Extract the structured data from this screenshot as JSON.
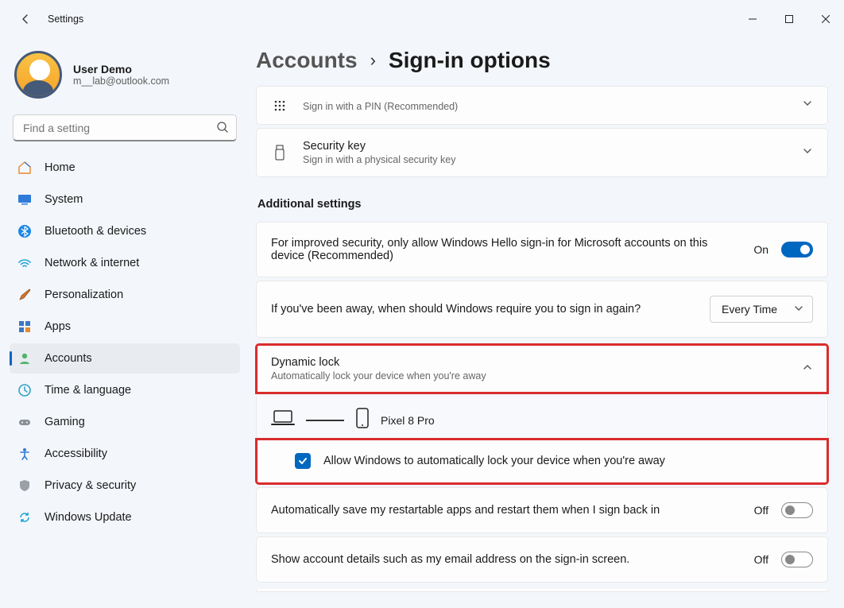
{
  "window": {
    "title": "Settings"
  },
  "user": {
    "name": "User Demo",
    "email": "m__lab@outlook.com"
  },
  "search": {
    "placeholder": "Find a setting"
  },
  "nav": [
    {
      "key": "home",
      "label": "Home"
    },
    {
      "key": "system",
      "label": "System"
    },
    {
      "key": "bluetooth",
      "label": "Bluetooth & devices"
    },
    {
      "key": "network",
      "label": "Network & internet"
    },
    {
      "key": "personalization",
      "label": "Personalization"
    },
    {
      "key": "apps",
      "label": "Apps"
    },
    {
      "key": "accounts",
      "label": "Accounts",
      "active": true
    },
    {
      "key": "time",
      "label": "Time & language"
    },
    {
      "key": "gaming",
      "label": "Gaming"
    },
    {
      "key": "accessibility",
      "label": "Accessibility"
    },
    {
      "key": "privacy",
      "label": "Privacy & security"
    },
    {
      "key": "update",
      "label": "Windows Update"
    }
  ],
  "breadcrumb": {
    "parent": "Accounts",
    "current": "Sign-in options"
  },
  "signin_methods": {
    "pin": {
      "title_visible_sub": "Sign in with a PIN (Recommended)"
    },
    "security_key": {
      "title": "Security key",
      "sub": "Sign in with a physical security key"
    }
  },
  "additional_header": "Additional settings",
  "hello_only": {
    "label": "For improved security, only allow Windows Hello sign-in for Microsoft accounts on this device (Recommended)",
    "state_text": "On"
  },
  "require_signin": {
    "label": "If you've been away, when should Windows require you to sign in again?",
    "value": "Every Time"
  },
  "dynamic_lock": {
    "title": "Dynamic lock",
    "sub": "Automatically lock your device when you're away",
    "device": "Pixel 8 Pro",
    "checkbox_label": "Allow Windows to automatically lock your device when you're away"
  },
  "restart_apps": {
    "label": "Automatically save my restartable apps and restart them when I sign back in",
    "state_text": "Off"
  },
  "show_details": {
    "label": "Show account details such as my email address on the sign-in screen.",
    "state_text": "Off"
  }
}
